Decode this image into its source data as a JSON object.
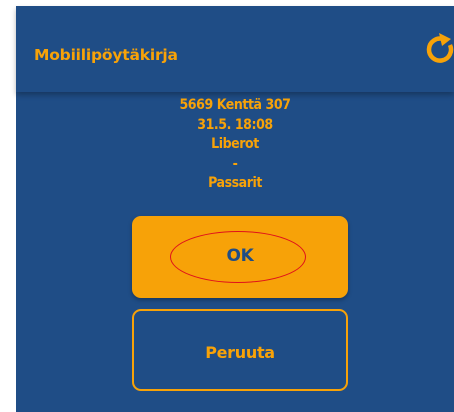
{
  "app_bar": {
    "title": "Mobiilipöytäkirja",
    "refresh_icon": "refresh-icon"
  },
  "match": {
    "code_venue": "5669 Kenttä 307",
    "datetime": "31.5. 18:08",
    "home_team": "Liberot",
    "separator": "-",
    "away_team": "Passarit"
  },
  "actions": {
    "ok_label": "OK",
    "cancel_label": "Peruuta"
  },
  "colors": {
    "background": "#1f4d86",
    "accent": "#f7a208",
    "highlight": "#e0121b"
  }
}
